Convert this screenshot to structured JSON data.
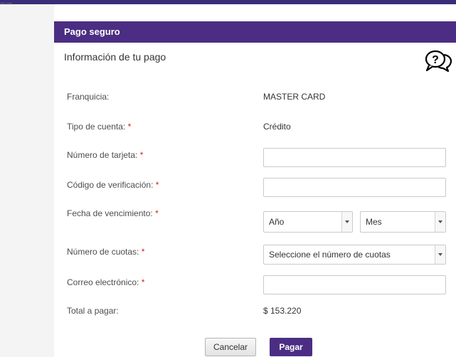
{
  "top_strip": {
    "dots": "..... ....."
  },
  "panel": {
    "title": "Pago seguro",
    "subtitle": "Información de tu pago"
  },
  "fields": {
    "franquicia": {
      "label": "Franquicia:",
      "value": "MASTER CARD"
    },
    "tipo_cuenta": {
      "label": "Tipo de cuenta:",
      "required": "*",
      "value": "Crédito"
    },
    "numero_tarjeta": {
      "label": "Número de tarjeta:",
      "required": "*",
      "value": ""
    },
    "codigo_verificacion": {
      "label": "Código de verificación:",
      "required": "*",
      "value": ""
    },
    "fecha_vencimiento": {
      "label": "Fecha de vencimiento:",
      "required": "*",
      "year_selected": "Año",
      "month_selected": "Mes"
    },
    "numero_cuotas": {
      "label": "Número de cuotas:",
      "required": "*",
      "selected": "Seleccione el número de cuotas"
    },
    "correo": {
      "label": "Correo electrónico:",
      "required": "*",
      "value": ""
    },
    "total": {
      "label": "Total a pagar:",
      "value": "$ 153.220"
    }
  },
  "buttons": {
    "cancel": "Cancelar",
    "pay": "Pagar"
  },
  "icons": {
    "help": "help-chat-icon"
  },
  "colors": {
    "brand": "#4b2e83",
    "required": "#cc1f1f",
    "border": "#c9c9c9"
  }
}
